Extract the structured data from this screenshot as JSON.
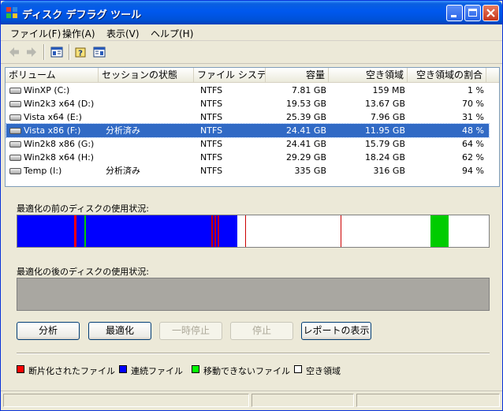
{
  "window": {
    "title": "ディスク デフラグ ツール"
  },
  "menubar": [
    {
      "label": "ファイル(F)"
    },
    {
      "label": "操作(A)"
    },
    {
      "label": "表示(V)"
    },
    {
      "label": "ヘルプ(H)"
    }
  ],
  "columns": [
    {
      "label": "ボリューム"
    },
    {
      "label": "セッションの状態"
    },
    {
      "label": "ファイル システム"
    },
    {
      "label": "容量"
    },
    {
      "label": "空き領域"
    },
    {
      "label": "空き領域の割合"
    }
  ],
  "volumes": [
    {
      "name": "WinXP (C:)",
      "session": "",
      "fs": "NTFS",
      "capacity": "7.81 GB",
      "free": "159 MB",
      "pct": "1 %",
      "selected": false
    },
    {
      "name": "Win2k3 x64 (D:)",
      "session": "",
      "fs": "NTFS",
      "capacity": "19.53 GB",
      "free": "13.67 GB",
      "pct": "70 %",
      "selected": false
    },
    {
      "name": "Vista x64 (E:)",
      "session": "",
      "fs": "NTFS",
      "capacity": "25.39 GB",
      "free": "7.96 GB",
      "pct": "31 %",
      "selected": false
    },
    {
      "name": "Vista x86 (F:)",
      "session": "分析済み",
      "fs": "NTFS",
      "capacity": "24.41 GB",
      "free": "11.95 GB",
      "pct": "48 %",
      "selected": true
    },
    {
      "name": "Win2k8 x86 (G:)",
      "session": "",
      "fs": "NTFS",
      "capacity": "24.41 GB",
      "free": "15.79 GB",
      "pct": "64 %",
      "selected": false
    },
    {
      "name": "Win2k8 x64 (H:)",
      "session": "",
      "fs": "NTFS",
      "capacity": "29.29 GB",
      "free": "18.24 GB",
      "pct": "62 %",
      "selected": false
    },
    {
      "name": "Temp (I:)",
      "session": "分析済み",
      "fs": "NTFS",
      "capacity": "335 GB",
      "free": "316 GB",
      "pct": "94 %",
      "selected": false
    }
  ],
  "usage": {
    "before_label": "最適化の前のディスクの使用状況:",
    "after_label": "最適化の後のディスクの使用状況:"
  },
  "buttons": {
    "analyze": "分析",
    "defragment": "最適化",
    "pause": "一時停止",
    "stop": "停止",
    "report": "レポートの表示"
  },
  "legend": [
    {
      "label": "断片化されたファイル",
      "color": "#ff0000"
    },
    {
      "label": "連続ファイル",
      "color": "#0000ff"
    },
    {
      "label": "移動できないファイル",
      "color": "#00ff00"
    },
    {
      "label": "空き領域",
      "color": "#ffffff"
    }
  ],
  "colors": {
    "contiguous": "#0000ff",
    "fragmented": "#ff0000",
    "unmovable": "#00cc00",
    "free": "#ffffff",
    "after_empty": "#a9a7a1"
  },
  "icons": {
    "app": "defrag-app-icon",
    "back": "back-arrow-icon",
    "forward": "forward-arrow-icon",
    "console_tree": "console-tree-icon",
    "help": "help-icon",
    "properties": "properties-icon",
    "drive": "hard-drive-icon"
  }
}
